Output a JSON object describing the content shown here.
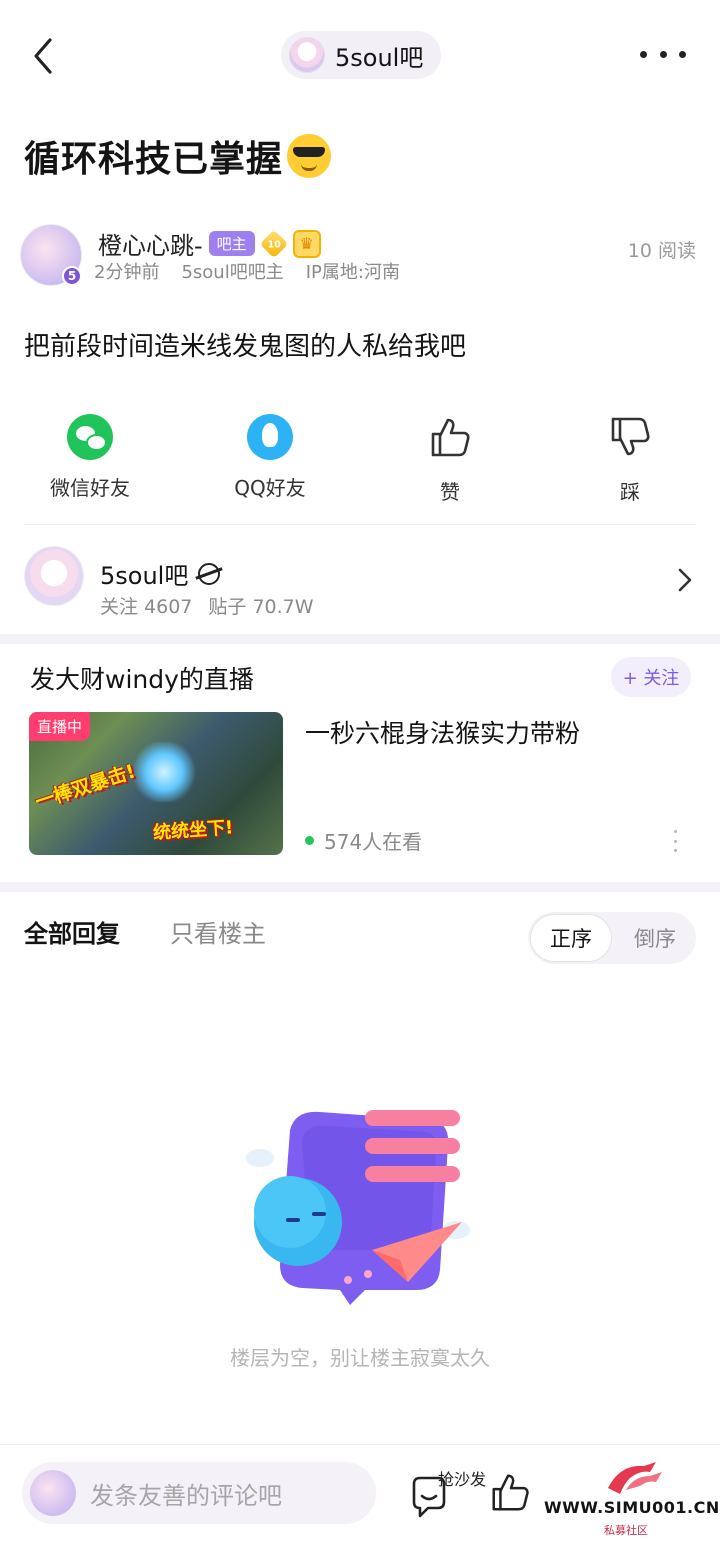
{
  "header": {
    "forum_pill_label": "5soul吧"
  },
  "post": {
    "title": "循环科技已掌握",
    "author": {
      "name": "橙心心跳-",
      "role_tag": "吧主",
      "level": "10",
      "avatar_badge": "5",
      "time": "2分钟前",
      "title_label": "5soul吧吧主",
      "ip_location": "IP属地:河南"
    },
    "read_count": "10 阅读",
    "body": "把前段时间造米线发鬼图的人私给我吧"
  },
  "actions": [
    {
      "label": "微信好友",
      "icon": "wechat-icon"
    },
    {
      "label": "QQ好友",
      "icon": "qq-icon"
    },
    {
      "label": "赞",
      "icon": "thumbs-up-icon"
    },
    {
      "label": "踩",
      "icon": "thumbs-down-icon"
    }
  ],
  "forum_card": {
    "name": "5soul吧",
    "followers": "关注 4607",
    "posts": "贴子 70.7W"
  },
  "live": {
    "streamer_title": "发大财windy的直播",
    "follow_label": "+ 关注",
    "tag": "直播中",
    "thumb_caption_1": "一棒双暴击!",
    "thumb_caption_2": "统统坐下!",
    "description": "一秒六棍身法猴实力带粉",
    "viewers": "574人在看"
  },
  "replies": {
    "tab_all": "全部回复",
    "tab_op_only": "只看楼主",
    "sort_asc": "正序",
    "sort_desc": "倒序",
    "empty_text": "楼层为空，别让楼主寂寞太久"
  },
  "bottom_bar": {
    "comment_placeholder": "发条友善的评论吧",
    "sofa_label": "抢沙发"
  },
  "watermark": {
    "url": "WWW.SIMU001.CN",
    "subtitle": "私募社区"
  },
  "colors": {
    "accent": "#7c5ce0",
    "wechat": "#21c45b",
    "qq": "#2db3f5",
    "live_tag": "#ff3d6e",
    "online_dot": "#22c55e"
  }
}
